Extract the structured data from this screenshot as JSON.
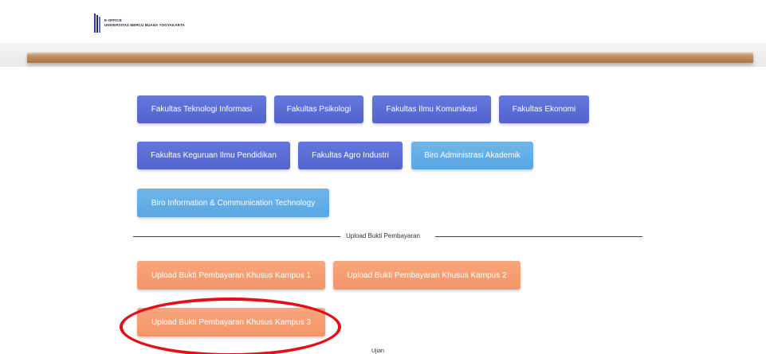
{
  "header": {
    "logo_line1": "E-OFFICE",
    "logo_line2": "UNIVERSITAS MERCU BUANA YOGYAKARTA"
  },
  "faculty_buttons": [
    {
      "label": "Fakultas Teknologi Informasi"
    },
    {
      "label": "Fakultas Psikologi"
    },
    {
      "label": "Fakultas Ilmu Komunikasi"
    },
    {
      "label": "Fakultas Ekonomi"
    },
    {
      "label": "Fakultas Keguruan Ilmu Pendidikan"
    },
    {
      "label": "Fakultas Agro Industri"
    },
    {
      "label": "Biro Administrasi Akademik"
    },
    {
      "label": "Biro Information & Communication Technology"
    }
  ],
  "upload_section": {
    "title": "Upload Bukti Pembayaran",
    "buttons": [
      {
        "label": "Upload Bukti Pembayaran Khusus Kampus 1"
      },
      {
        "label": "Upload Bukti Pembayaran Khusus Kampus 2"
      },
      {
        "label": "Upload Bukti Pembayaran Khusus Kampus 3"
      }
    ]
  },
  "next_section": {
    "title": "Ujian"
  },
  "colors": {
    "faculty_button": "#5a6ed6",
    "biro_button": "#66aee6",
    "upload_button": "#f69d72",
    "highlight": "#e3101a"
  }
}
